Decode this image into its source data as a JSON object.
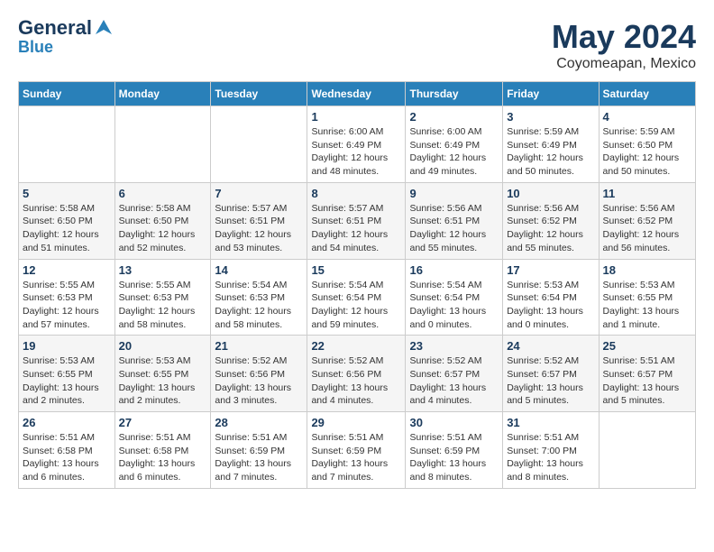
{
  "header": {
    "logo_general": "General",
    "logo_blue": "Blue",
    "month_year": "May 2024",
    "location": "Coyomeapan, Mexico"
  },
  "calendar": {
    "days_of_week": [
      "Sunday",
      "Monday",
      "Tuesday",
      "Wednesday",
      "Thursday",
      "Friday",
      "Saturday"
    ],
    "weeks": [
      [
        {
          "day": "",
          "info": ""
        },
        {
          "day": "",
          "info": ""
        },
        {
          "day": "",
          "info": ""
        },
        {
          "day": "1",
          "info": "Sunrise: 6:00 AM\nSunset: 6:49 PM\nDaylight: 12 hours\nand 48 minutes."
        },
        {
          "day": "2",
          "info": "Sunrise: 6:00 AM\nSunset: 6:49 PM\nDaylight: 12 hours\nand 49 minutes."
        },
        {
          "day": "3",
          "info": "Sunrise: 5:59 AM\nSunset: 6:49 PM\nDaylight: 12 hours\nand 50 minutes."
        },
        {
          "day": "4",
          "info": "Sunrise: 5:59 AM\nSunset: 6:50 PM\nDaylight: 12 hours\nand 50 minutes."
        }
      ],
      [
        {
          "day": "5",
          "info": "Sunrise: 5:58 AM\nSunset: 6:50 PM\nDaylight: 12 hours\nand 51 minutes."
        },
        {
          "day": "6",
          "info": "Sunrise: 5:58 AM\nSunset: 6:50 PM\nDaylight: 12 hours\nand 52 minutes."
        },
        {
          "day": "7",
          "info": "Sunrise: 5:57 AM\nSunset: 6:51 PM\nDaylight: 12 hours\nand 53 minutes."
        },
        {
          "day": "8",
          "info": "Sunrise: 5:57 AM\nSunset: 6:51 PM\nDaylight: 12 hours\nand 54 minutes."
        },
        {
          "day": "9",
          "info": "Sunrise: 5:56 AM\nSunset: 6:51 PM\nDaylight: 12 hours\nand 55 minutes."
        },
        {
          "day": "10",
          "info": "Sunrise: 5:56 AM\nSunset: 6:52 PM\nDaylight: 12 hours\nand 55 minutes."
        },
        {
          "day": "11",
          "info": "Sunrise: 5:56 AM\nSunset: 6:52 PM\nDaylight: 12 hours\nand 56 minutes."
        }
      ],
      [
        {
          "day": "12",
          "info": "Sunrise: 5:55 AM\nSunset: 6:53 PM\nDaylight: 12 hours\nand 57 minutes."
        },
        {
          "day": "13",
          "info": "Sunrise: 5:55 AM\nSunset: 6:53 PM\nDaylight: 12 hours\nand 58 minutes."
        },
        {
          "day": "14",
          "info": "Sunrise: 5:54 AM\nSunset: 6:53 PM\nDaylight: 12 hours\nand 58 minutes."
        },
        {
          "day": "15",
          "info": "Sunrise: 5:54 AM\nSunset: 6:54 PM\nDaylight: 12 hours\nand 59 minutes."
        },
        {
          "day": "16",
          "info": "Sunrise: 5:54 AM\nSunset: 6:54 PM\nDaylight: 13 hours\nand 0 minutes."
        },
        {
          "day": "17",
          "info": "Sunrise: 5:53 AM\nSunset: 6:54 PM\nDaylight: 13 hours\nand 0 minutes."
        },
        {
          "day": "18",
          "info": "Sunrise: 5:53 AM\nSunset: 6:55 PM\nDaylight: 13 hours\nand 1 minute."
        }
      ],
      [
        {
          "day": "19",
          "info": "Sunrise: 5:53 AM\nSunset: 6:55 PM\nDaylight: 13 hours\nand 2 minutes."
        },
        {
          "day": "20",
          "info": "Sunrise: 5:53 AM\nSunset: 6:55 PM\nDaylight: 13 hours\nand 2 minutes."
        },
        {
          "day": "21",
          "info": "Sunrise: 5:52 AM\nSunset: 6:56 PM\nDaylight: 13 hours\nand 3 minutes."
        },
        {
          "day": "22",
          "info": "Sunrise: 5:52 AM\nSunset: 6:56 PM\nDaylight: 13 hours\nand 4 minutes."
        },
        {
          "day": "23",
          "info": "Sunrise: 5:52 AM\nSunset: 6:57 PM\nDaylight: 13 hours\nand 4 minutes."
        },
        {
          "day": "24",
          "info": "Sunrise: 5:52 AM\nSunset: 6:57 PM\nDaylight: 13 hours\nand 5 minutes."
        },
        {
          "day": "25",
          "info": "Sunrise: 5:51 AM\nSunset: 6:57 PM\nDaylight: 13 hours\nand 5 minutes."
        }
      ],
      [
        {
          "day": "26",
          "info": "Sunrise: 5:51 AM\nSunset: 6:58 PM\nDaylight: 13 hours\nand 6 minutes."
        },
        {
          "day": "27",
          "info": "Sunrise: 5:51 AM\nSunset: 6:58 PM\nDaylight: 13 hours\nand 6 minutes."
        },
        {
          "day": "28",
          "info": "Sunrise: 5:51 AM\nSunset: 6:59 PM\nDaylight: 13 hours\nand 7 minutes."
        },
        {
          "day": "29",
          "info": "Sunrise: 5:51 AM\nSunset: 6:59 PM\nDaylight: 13 hours\nand 7 minutes."
        },
        {
          "day": "30",
          "info": "Sunrise: 5:51 AM\nSunset: 6:59 PM\nDaylight: 13 hours\nand 8 minutes."
        },
        {
          "day": "31",
          "info": "Sunrise: 5:51 AM\nSunset: 7:00 PM\nDaylight: 13 hours\nand 8 minutes."
        },
        {
          "day": "",
          "info": ""
        }
      ]
    ]
  }
}
